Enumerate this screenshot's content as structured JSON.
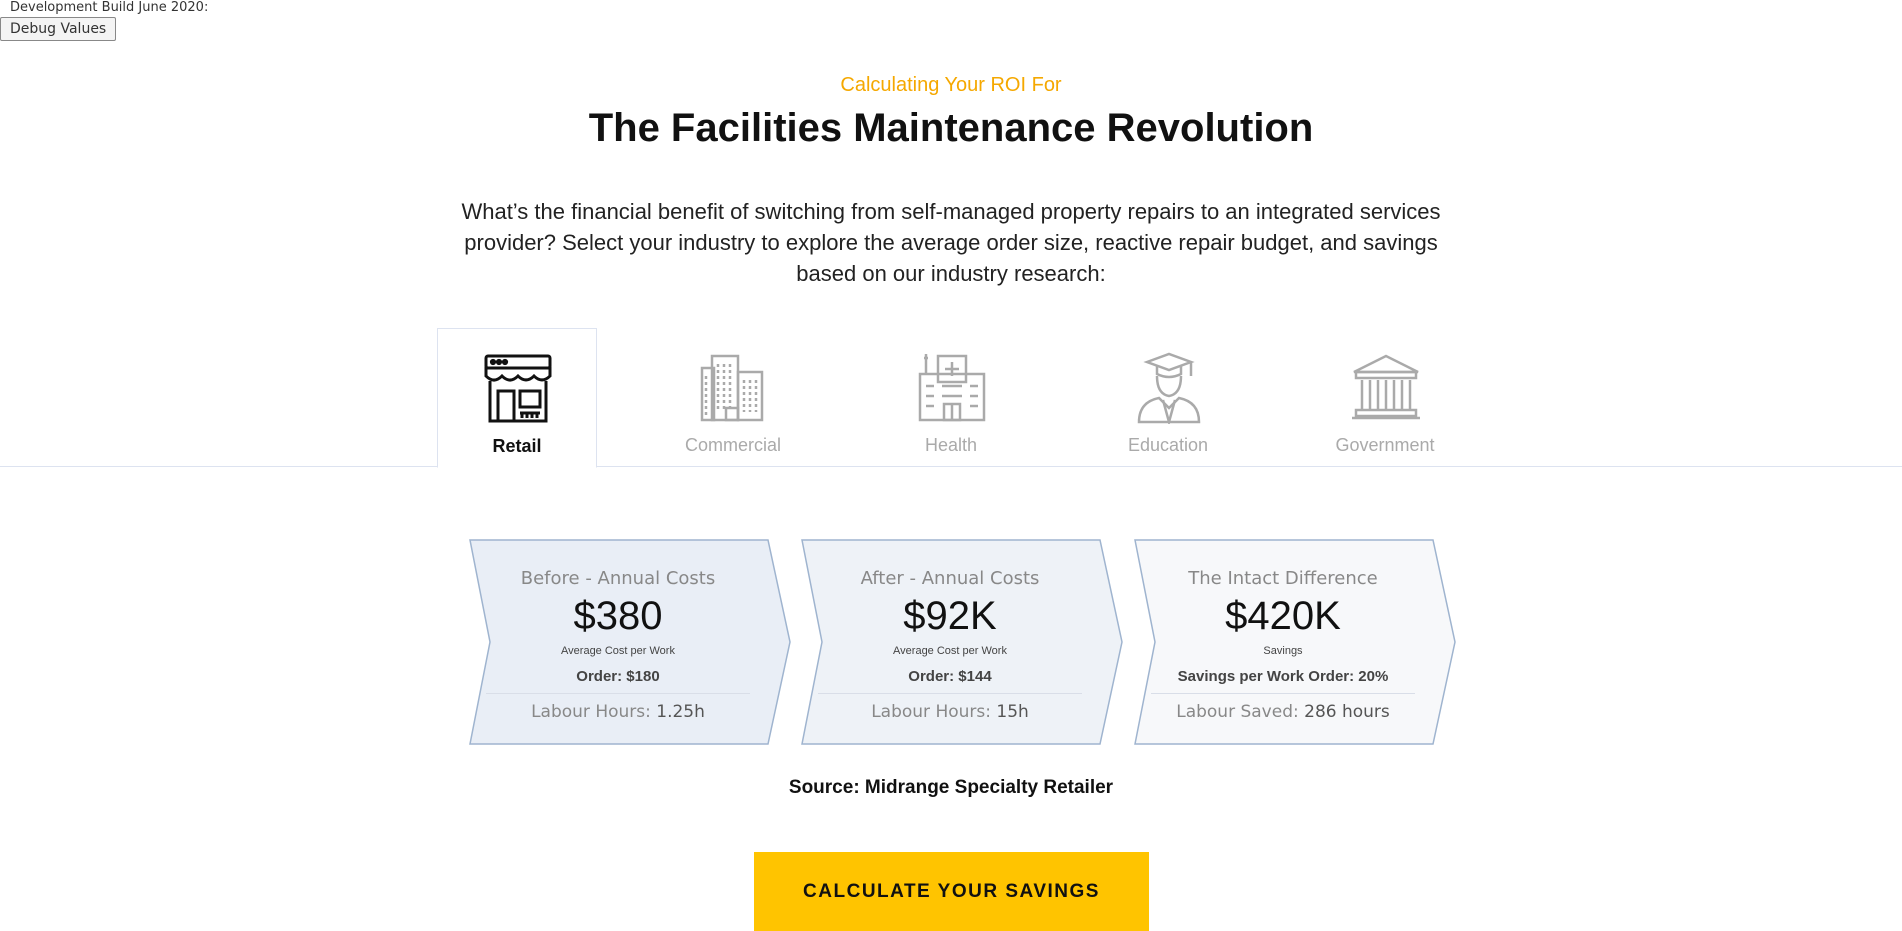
{
  "dev": {
    "build_label": "Development Build June 2020:",
    "debug_button": "Debug Values"
  },
  "header": {
    "kicker": "Calculating Your ROI For",
    "title": "The Facilities Maintenance Revolution",
    "intro": "What’s the financial benefit of switching from self-managed property repairs to an integrated services provider? Select your industry to explore the average order size, reactive repair budget, and savings based on our industry research:"
  },
  "tabs": [
    {
      "label": "Retail",
      "icon": "storefront-icon",
      "active": true
    },
    {
      "label": "Commercial",
      "icon": "office-buildings-icon",
      "active": false
    },
    {
      "label": "Health",
      "icon": "hospital-icon",
      "active": false
    },
    {
      "label": "Education",
      "icon": "graduate-icon",
      "active": false
    },
    {
      "label": "Government",
      "icon": "government-building-icon",
      "active": false
    }
  ],
  "cards": [
    {
      "heading": "Before - Annual Costs",
      "big_value": "$380",
      "small_label": "Average Cost per Work",
      "order_line": "Order: $180",
      "foot_label": "Labour Hours:",
      "foot_value": "1.25h",
      "fill": "#e9eef6"
    },
    {
      "heading": "After - Annual Costs",
      "big_value": "$92K",
      "small_label": "Average Cost per Work",
      "order_line": "Order: $144",
      "foot_label": "Labour Hours:",
      "foot_value": "15h",
      "fill": "#eef2f7"
    },
    {
      "heading": "The Intact Difference",
      "big_value": "$420K",
      "small_label": "Savings",
      "order_line": "Savings per Work Order: 20%",
      "foot_label": "Labour Saved:",
      "foot_value": "286 hours",
      "fill": "#f7f8fa"
    }
  ],
  "source": "Source: Midrange Specialty Retailer",
  "cta_label": "CALCULATE YOUR SAVINGS",
  "colors": {
    "accent": "#f5a800",
    "cta": "#ffc400",
    "card_stroke": "#9fb4cf",
    "inactive": "#aaaaaa"
  }
}
